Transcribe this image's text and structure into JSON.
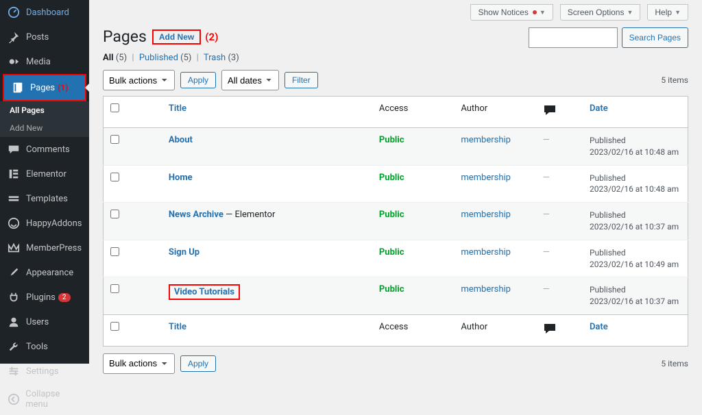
{
  "sidebar": {
    "items": [
      {
        "label": "Dashboard",
        "icon": "dashboard"
      },
      {
        "label": "Posts",
        "icon": "pin"
      },
      {
        "label": "Media",
        "icon": "media"
      },
      {
        "label": "Pages",
        "icon": "page",
        "active": true,
        "annotation": "(1)"
      },
      {
        "label": "Comments",
        "icon": "comment"
      },
      {
        "label": "Elementor",
        "icon": "elementor"
      },
      {
        "label": "Templates",
        "icon": "templates"
      },
      {
        "label": "HappyAddons",
        "icon": "happy"
      },
      {
        "label": "MemberPress",
        "icon": "memberpress"
      },
      {
        "label": "Appearance",
        "icon": "brush"
      },
      {
        "label": "Plugins",
        "icon": "plug",
        "badge": "2"
      },
      {
        "label": "Users",
        "icon": "user"
      },
      {
        "label": "Tools",
        "icon": "wrench"
      },
      {
        "label": "Settings",
        "icon": "settings"
      },
      {
        "label": "Collapse menu",
        "icon": "collapse"
      }
    ],
    "sub": [
      {
        "label": "All Pages",
        "current": true
      },
      {
        "label": "Add New"
      }
    ]
  },
  "topbar": {
    "show_notices": "Show Notices",
    "screen_options": "Screen Options",
    "help": "Help"
  },
  "header": {
    "title": "Pages",
    "addnew": "Add New",
    "annotation": "(2)"
  },
  "subsub": {
    "all": "All",
    "all_count": "(5)",
    "published": "Published",
    "published_count": "(5)",
    "trash": "Trash",
    "trash_count": "(3)"
  },
  "search": {
    "button": "Search Pages",
    "placeholder": ""
  },
  "filters": {
    "bulk": "Bulk actions",
    "apply": "Apply",
    "dates": "All dates",
    "filter": "Filter"
  },
  "count_text": "5 items",
  "columns": {
    "title": "Title",
    "access": "Access",
    "author": "Author",
    "date": "Date"
  },
  "rows": [
    {
      "title": "About",
      "suffix": "",
      "access": "Public",
      "author": "membership",
      "comments": "—",
      "status": "Published",
      "date": "2023/02/16 at 10:48 am"
    },
    {
      "title": "Home",
      "suffix": "",
      "access": "Public",
      "author": "membership",
      "comments": "—",
      "status": "Published",
      "date": "2023/02/16 at 10:48 am"
    },
    {
      "title": "News Archive",
      "suffix": " — Elementor",
      "access": "Public",
      "author": "membership",
      "comments": "—",
      "status": "Published",
      "date": "2023/02/16 at 10:37 am"
    },
    {
      "title": "Sign Up",
      "suffix": "",
      "access": "Public",
      "author": "membership",
      "comments": "—",
      "status": "Published",
      "date": "2023/02/16 at 10:49 am"
    },
    {
      "title": "Video Tutorials",
      "suffix": "",
      "access": "Public",
      "author": "membership",
      "comments": "—",
      "status": "Published",
      "date": "2023/02/16 at 10:37 am",
      "highlight": true
    }
  ]
}
